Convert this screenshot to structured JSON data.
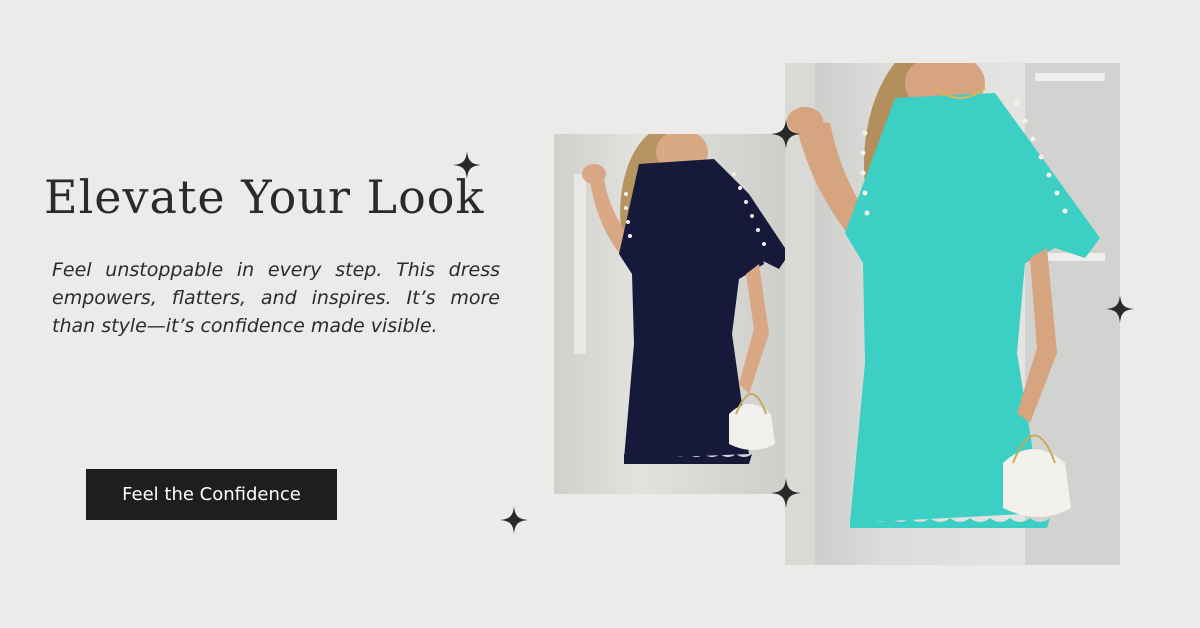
{
  "hero": {
    "headline": "Elevate Your Look",
    "body": "Feel unstoppable in every step. This dress empowers, flatters, and inspires. It’s more than style—it’s confidence made visible.",
    "cta_label": "Feel the Confidence"
  },
  "products": [
    {
      "name": "navy dress photo",
      "color": "#17193a"
    },
    {
      "name": "turquoise dress photo",
      "color": "#3ccfc4"
    }
  ],
  "colors": {
    "background": "#ecebe9",
    "text": "#2a2a2a",
    "button": "#1e1e1e",
    "button_text": "#ffffff"
  },
  "icons": [
    "sparkle-icon"
  ]
}
